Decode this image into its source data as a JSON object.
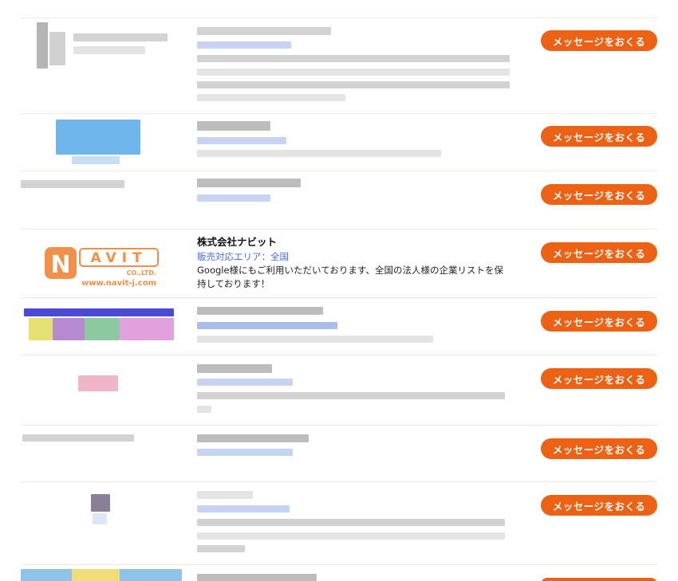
{
  "list": {
    "button_label": "メッセージをおくる",
    "featured": {
      "logo_letter": "N",
      "logo_word": "AVIT",
      "logo_sub": "CO.,LTD.",
      "logo_url": "www.navit-j.com",
      "company_name": "株式会社ナビット",
      "area": "販売対応エリア：全国",
      "description": "Google様にもご利用いただいております、全国の法人様の企業リストを保持しております！"
    }
  },
  "colors": {
    "button": "#ec6113",
    "link": "#4a6fd8",
    "logo_orange": "#f0904a"
  }
}
